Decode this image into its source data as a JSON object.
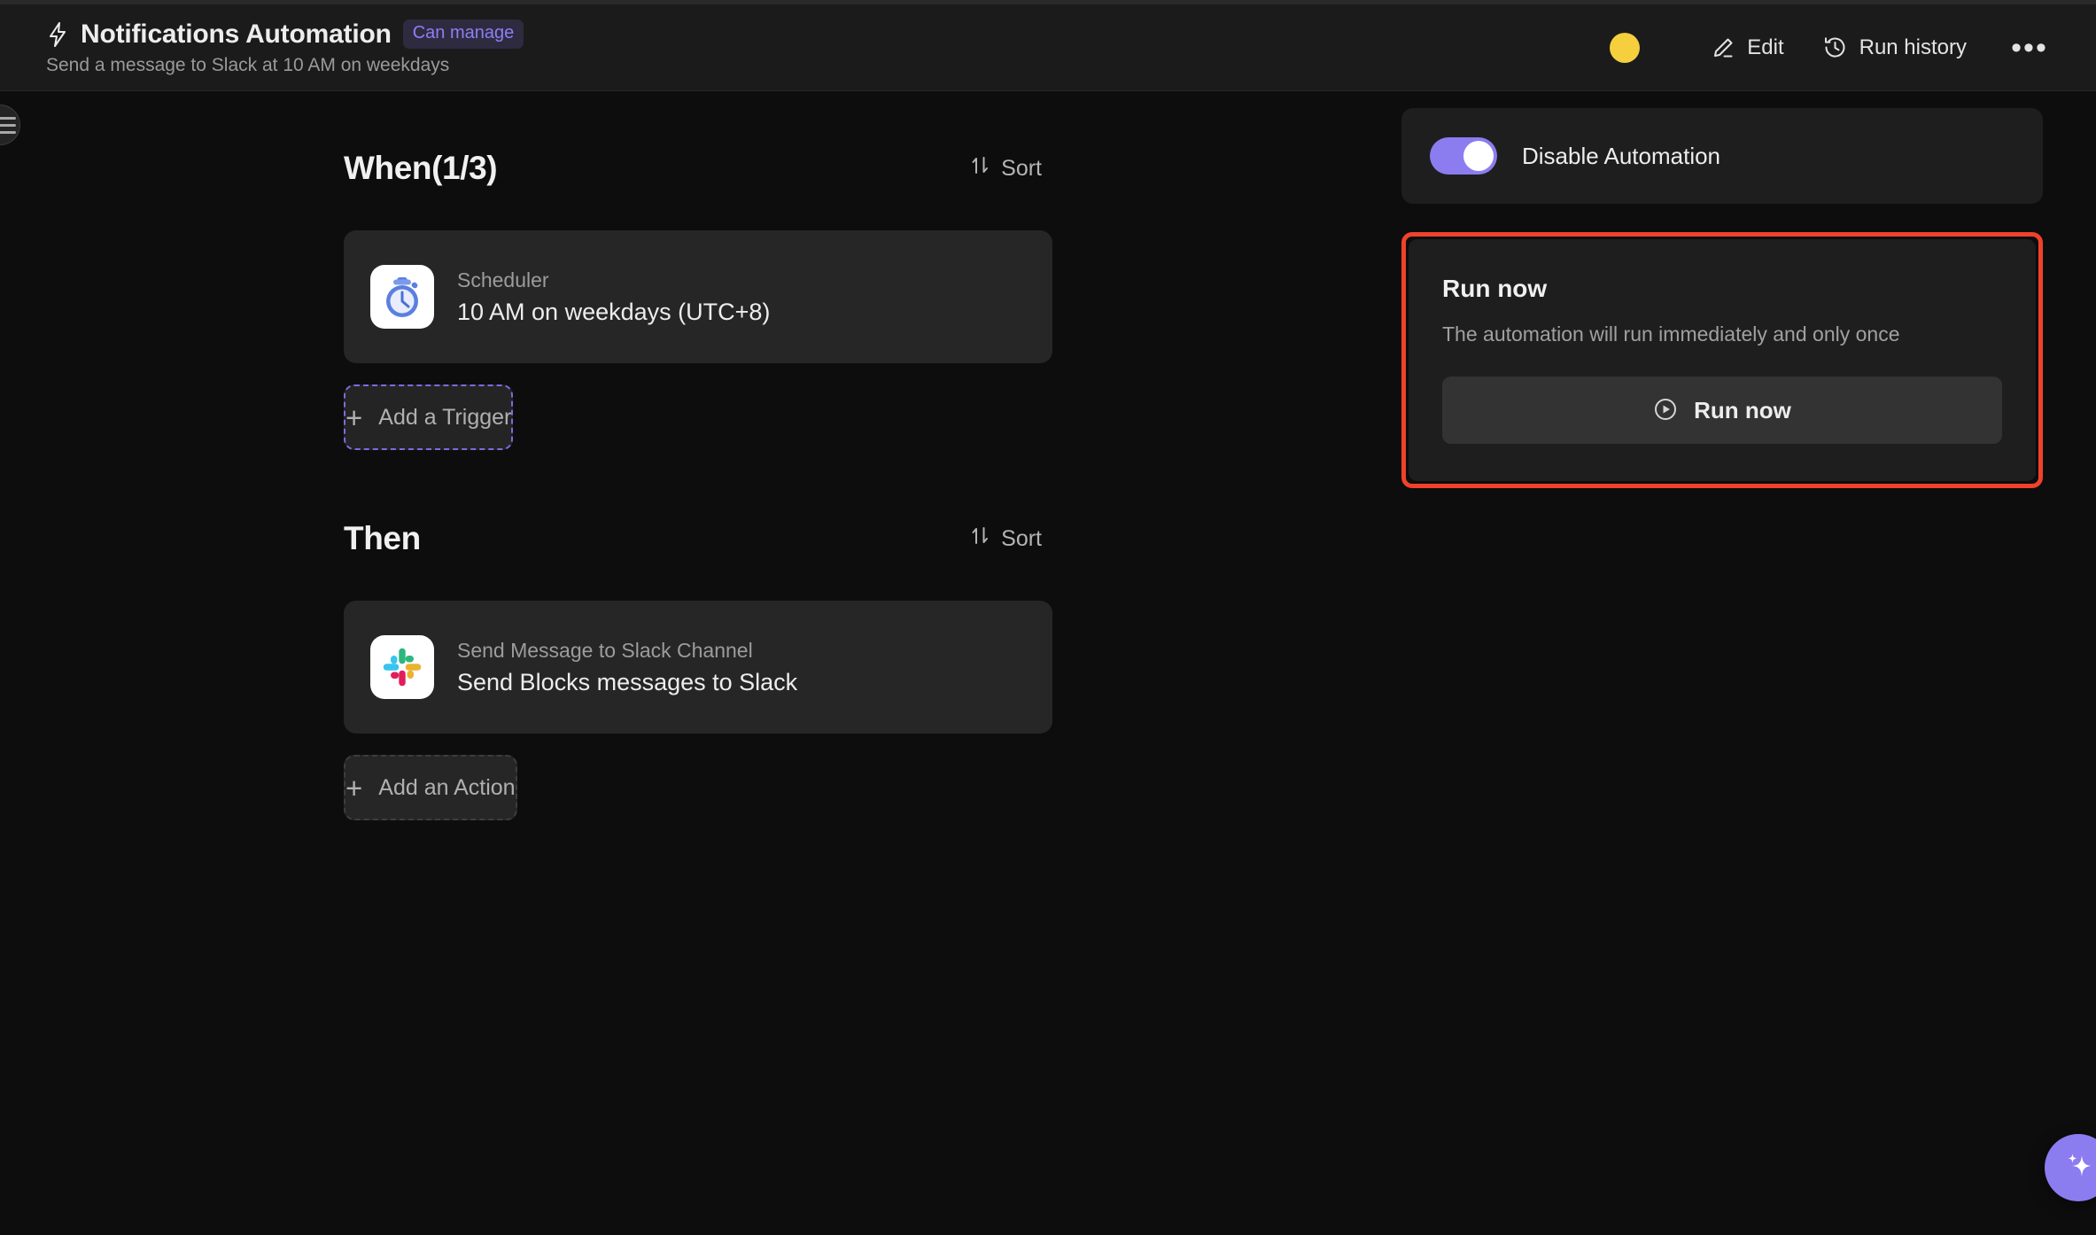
{
  "header": {
    "bolt_icon": "bolt-icon",
    "title": "Notifications Automation",
    "badge": "Can manage",
    "subtitle": "Send a message to Slack at 10 AM on weekdays",
    "status_dot_color": "#f5cf3d",
    "edit_label": "Edit",
    "edit_icon": "pencil-icon",
    "run_history_label": "Run history",
    "run_history_icon": "history-clock-icon",
    "more_label": "•••"
  },
  "sidebar_toggle": {
    "icon": "hamburger-icon"
  },
  "main": {
    "sections": [
      {
        "title": "When(1/3)",
        "sort_label": "Sort",
        "sort_icon": "sort-arrows-icon",
        "node": {
          "icon": "stopwatch-icon",
          "app": "Scheduler",
          "description": "10 AM on weekdays (UTC+8)"
        },
        "add_label": "Add a Trigger",
        "add_icon": "plus-icon",
        "add_style": "dashed-purple"
      },
      {
        "title": "Then",
        "sort_label": "Sort",
        "sort_icon": "sort-arrows-icon",
        "node": {
          "icon": "slack-icon",
          "app": "Send Message to Slack Channel",
          "description": "Send Blocks messages to Slack"
        },
        "add_label": "Add an Action",
        "add_icon": "plus-icon",
        "add_style": "dashed-gray"
      }
    ]
  },
  "right_panel": {
    "toggle": {
      "label": "Disable Automation",
      "state": "on",
      "accent_color": "#8b7cf0"
    },
    "run_now": {
      "title": "Run now",
      "description": "The automation will run immediately and only once",
      "button_label": "Run now",
      "button_icon": "play-circle-icon",
      "highlight_color": "#f0422a"
    }
  },
  "fab": {
    "icon": "sparkle-icon",
    "color": "#8b7cf0"
  },
  "colors": {
    "background": "#0d0d0d",
    "header_bg": "#1b1b1b",
    "card_bg": "#262626",
    "panel_card_bg": "#1e1e1e",
    "accent_purple": "#8b7cf0",
    "highlight_red": "#f0422a",
    "badge_text": "#8d7ff2",
    "badge_bg": "#2e2b40"
  }
}
